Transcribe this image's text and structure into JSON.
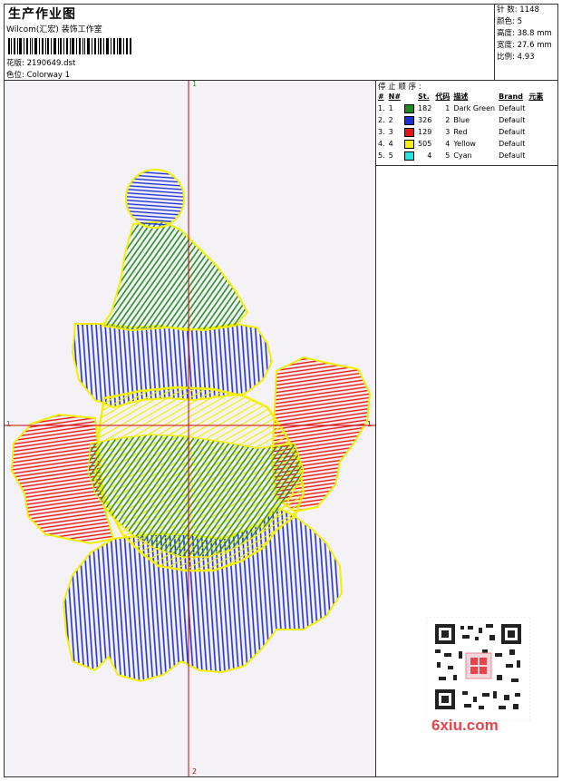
{
  "header": {
    "title": "生产作业图",
    "studio": "Wilcom(汇宏) 装饰工作室",
    "design_label": "花版:",
    "design_file": "2190649.dst",
    "colorway_label": "色位:",
    "colorway": "Colorway 1"
  },
  "stats": [
    {
      "label": "针 数:",
      "value": "1148"
    },
    {
      "label": "颜色:",
      "value": "5"
    },
    {
      "label": "高度:",
      "value": "38.8 mm"
    },
    {
      "label": "宽度:",
      "value": "27.6 mm"
    },
    {
      "label": "比例:",
      "value": "4.93"
    }
  ],
  "panel": {
    "caption": "停 止 顺 序 :",
    "columns": [
      "#",
      "N#",
      "St.",
      "代码",
      "描述",
      "Brand",
      "元素"
    ],
    "rows": [
      {
        "idx": "1.",
        "n": "1",
        "color": "#1a8a1a",
        "st": "182",
        "code": "1",
        "desc": "Dark Green",
        "brand": "Default"
      },
      {
        "idx": "2.",
        "n": "2",
        "color": "#1f2fd6",
        "st": "326",
        "code": "2",
        "desc": "Blue",
        "brand": "Default"
      },
      {
        "idx": "3.",
        "n": "3",
        "color": "#e81414",
        "st": "129",
        "code": "3",
        "desc": "Red",
        "brand": "Default"
      },
      {
        "idx": "4.",
        "n": "4",
        "color": "#f4f000",
        "st": "505",
        "code": "4",
        "desc": "Yellow",
        "brand": "Default"
      },
      {
        "idx": "5.",
        "n": "5",
        "color": "#20e6e6",
        "st": "4",
        "code": "5",
        "desc": "Cyan",
        "brand": "Default"
      }
    ]
  },
  "canvas": {
    "axis_top_label": "1",
    "axis_left_label": "1",
    "axis_right_label": "1",
    "axis_bottom_label": "2"
  },
  "watermark": {
    "site": "6xiu.com"
  }
}
